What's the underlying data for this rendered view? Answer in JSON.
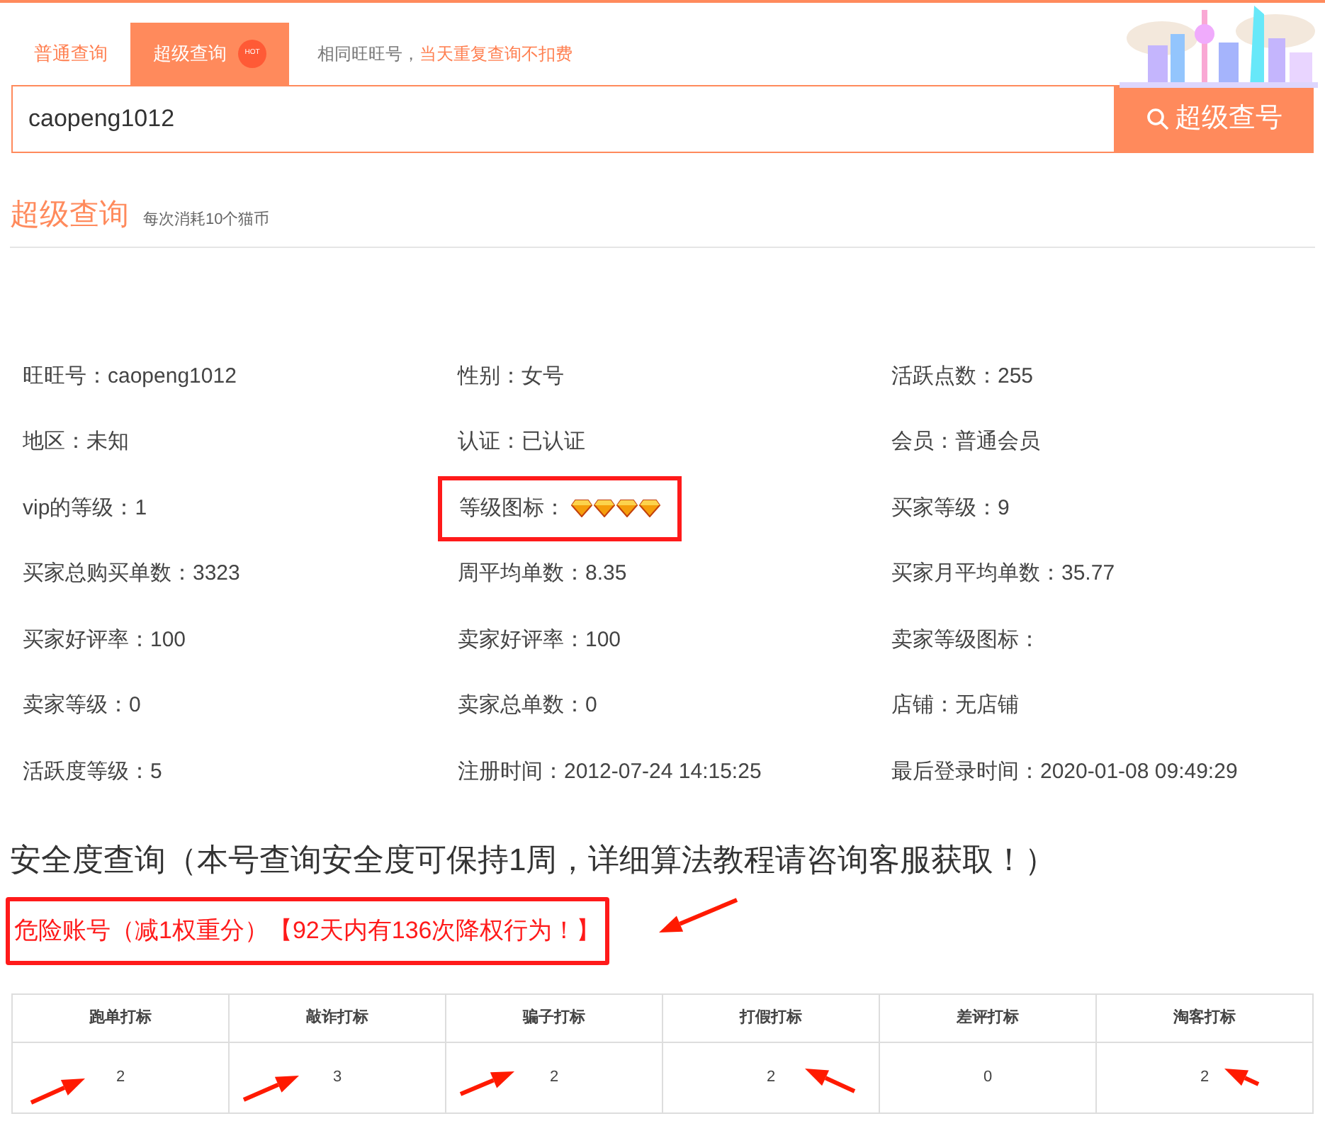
{
  "tabs": [
    {
      "label": "普通查询",
      "selected": false
    },
    {
      "label": "超级查询",
      "selected": true,
      "badge": "HOT"
    }
  ],
  "notice": {
    "text": "相同旺旺号，",
    "highlight": "当天重复查询不扣费"
  },
  "search": {
    "value": "caopeng1012",
    "button": "超级查号"
  },
  "section": {
    "title": "超级查询",
    "subtitle": "每次消耗10个猫币"
  },
  "fields": [
    {
      "kind": "text",
      "label": "旺旺号：",
      "value": "caopeng1012"
    },
    {
      "kind": "text",
      "label": "性别：",
      "value": "女号"
    },
    {
      "kind": "text",
      "label": "活跃点数：",
      "value": "255"
    },
    {
      "kind": "text",
      "label": "地区：",
      "value": "未知"
    },
    {
      "kind": "text",
      "label": "认证：",
      "value": "已认证"
    },
    {
      "kind": "text",
      "label": "会员：",
      "value": "普通会员"
    },
    {
      "kind": "text",
      "label": "vip的等级：",
      "value": "1"
    },
    {
      "kind": "icons",
      "label": "等级图标：",
      "stars": 4,
      "highlighted": true
    },
    {
      "kind": "text",
      "label": "买家等级：",
      "value": "9"
    },
    {
      "kind": "text",
      "label": "买家总购买单数：",
      "value": "3323"
    },
    {
      "kind": "text",
      "label": "周平均单数：",
      "value": "8.35"
    },
    {
      "kind": "text",
      "label": "买家月平均单数：",
      "value": "35.77"
    },
    {
      "kind": "text",
      "label": "买家好评率：",
      "value": "100"
    },
    {
      "kind": "text",
      "label": "卖家好评率：",
      "value": "100"
    },
    {
      "kind": "text",
      "label": "卖家等级图标："
    },
    {
      "kind": "text",
      "label": "卖家等级：",
      "value": "0"
    },
    {
      "kind": "text",
      "label": "卖家总单数：",
      "value": "0"
    },
    {
      "kind": "text",
      "label": "店铺：",
      "value": "无店铺"
    },
    {
      "kind": "text",
      "label": "活跃度等级：",
      "value": "5"
    },
    {
      "kind": "text",
      "label": "注册时间：",
      "value": "2012-07-24 14:15:25"
    },
    {
      "kind": "text",
      "label": "最后登录时间：",
      "value": "2020-01-08 09:49:29"
    }
  ],
  "safety": {
    "title": "安全度查询（本号查询安全度可保持1周，详细算法教程请咨询客服获取！）",
    "warning": "危险账号（减1权重分）【92天内有136次降权行为！】",
    "highlighted": true
  },
  "table": {
    "columns": [
      "跑单打标",
      "敲诈打标",
      "骗子打标",
      "打假打标",
      "差评打标",
      "淘客打标"
    ],
    "rows": [
      [
        "2",
        "3",
        "2",
        "2",
        "0",
        "2"
      ]
    ]
  }
}
